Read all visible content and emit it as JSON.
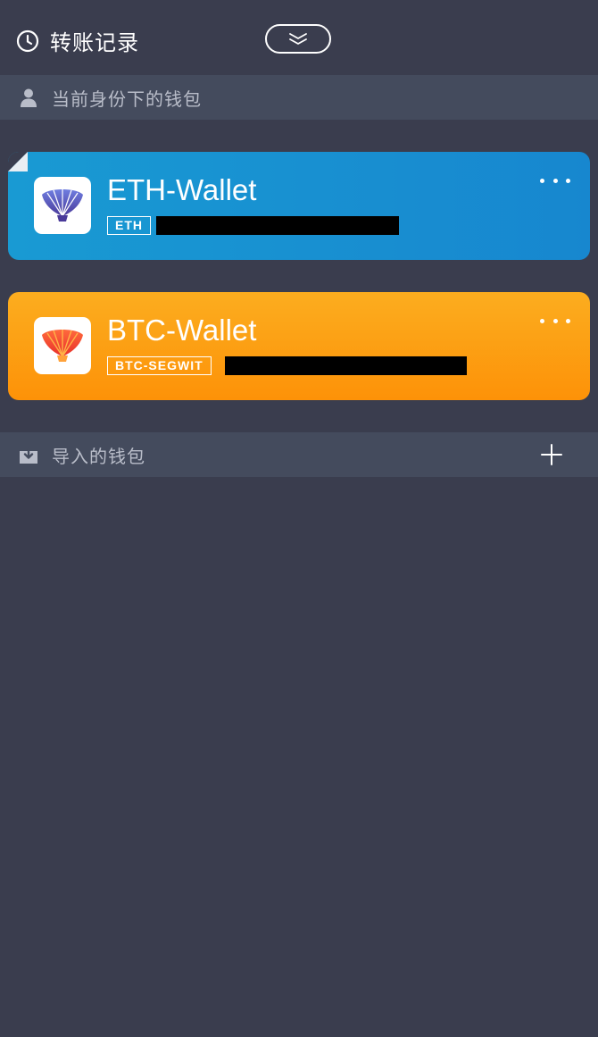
{
  "header": {
    "history_label": "转账记录"
  },
  "sections": {
    "identity_title": "当前身份下的钱包",
    "imported_title": "导入的钱包"
  },
  "wallets": [
    {
      "name": "ETH-Wallet",
      "tag": "ETH"
    },
    {
      "name": "BTC-Wallet",
      "tag": "BTC-SEGWIT"
    }
  ],
  "icons": {
    "history": "clock-icon",
    "collapse": "double-chevron-down-icon",
    "identity": "user-icon",
    "imported": "download-icon",
    "add": "plus-icon",
    "more": "ellipsis-icon"
  },
  "colors": {
    "background": "#3a3d4e",
    "section_bar": "#444b5d",
    "eth_card": "#1a92d2",
    "btc_card": "#fd9e14"
  }
}
